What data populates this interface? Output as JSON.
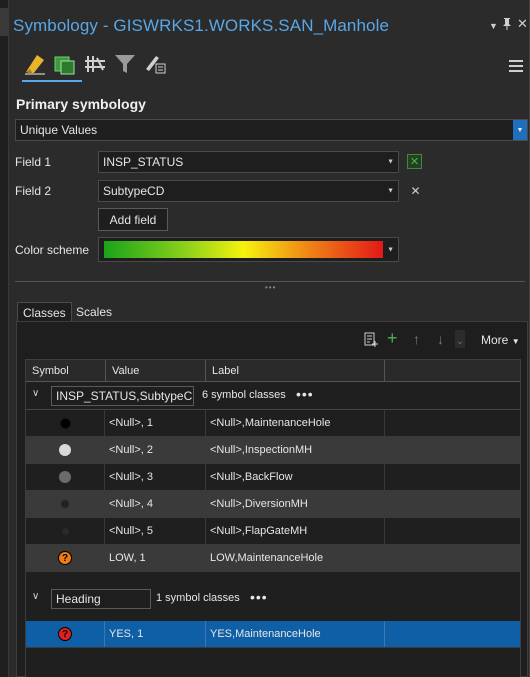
{
  "window": {
    "title": "Symbology - GISWRKS1.WORKS.SAN_Manhole",
    "pin_icon": "pin-icon",
    "close_icon": "close-icon",
    "menu_icon": "menu-dropdown-icon"
  },
  "toolbar": {
    "tools": [
      "primary-symbology-icon",
      "vary-symbology-icon",
      "symbol-layers-icon",
      "filter-icon",
      "label-classes-icon"
    ]
  },
  "primary": {
    "section_title": "Primary symbology",
    "renderer": "Unique Values",
    "field1_label": "Field 1",
    "field1_value": "INSP_STATUS",
    "field2_label": "Field 2",
    "field2_value": "SubtypeCD",
    "add_field_label": "Add field",
    "color_scheme_label": "Color scheme"
  },
  "tabs": {
    "classes": "Classes",
    "scales": "Scales",
    "more_label": "More"
  },
  "grid": {
    "columns": [
      "Symbol",
      "Value",
      "Label"
    ],
    "group1": {
      "heading": "INSP_STATUS,SubtypeCD",
      "count": "6 symbol classes",
      "rows": [
        {
          "value": "<Null>, 1",
          "label": "<Null>,MaintenanceHole"
        },
        {
          "value": "<Null>, 2",
          "label": "<Null>,InspectionMH"
        },
        {
          "value": "<Null>, 3",
          "label": "<Null>,BackFlow"
        },
        {
          "value": "<Null>, 4",
          "label": "<Null>,DiversionMH"
        },
        {
          "value": "<Null>, 5",
          "label": "<Null>,FlapGateMH"
        },
        {
          "value": "LOW, 1",
          "label": "LOW,MaintenanceHole"
        }
      ]
    },
    "group2": {
      "heading": "Heading",
      "count": "1 symbol classes",
      "rows": [
        {
          "value": "YES, 1",
          "label": "YES,MaintenanceHole"
        }
      ]
    }
  },
  "colors": {
    "accent": "#59a7e6",
    "selection": "#0f5fa6",
    "question_orange": "#f07b14",
    "question_red": "#e0211f"
  }
}
